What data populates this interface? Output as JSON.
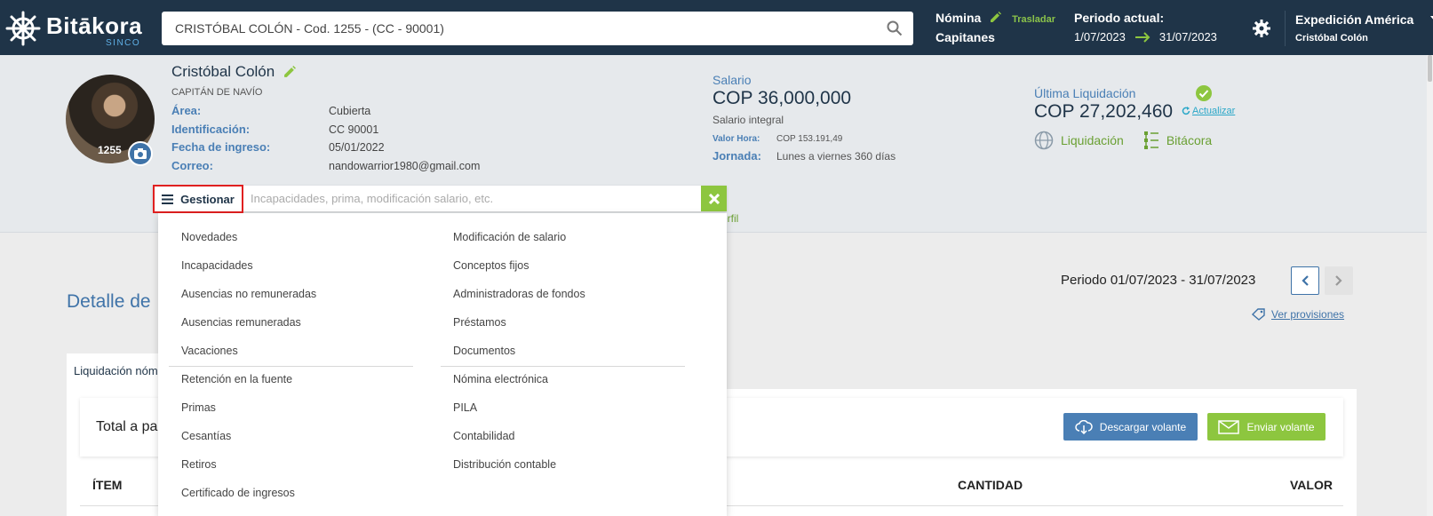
{
  "app": {
    "brand": "Bitākora",
    "sub_brand": "SINCO"
  },
  "search": {
    "value": "CRISTÓBAL COLÓN - Cod. 1255 - (CC - 90001)"
  },
  "nomina": {
    "title": "Nómina",
    "trasladar": "Trasladar",
    "name": "Capitanes"
  },
  "periodo_actual": {
    "label": "Periodo actual:",
    "start": "1/07/2023",
    "end": "31/07/2023"
  },
  "company": {
    "name": "Expedición América",
    "user": "Cristóbal Colón"
  },
  "employee": {
    "name": "Cristóbal Colón",
    "role": "CAPITÁN DE NAVÍO",
    "code": "1255",
    "fields": [
      {
        "label": "Área:",
        "value": "Cubierta"
      },
      {
        "label": "Identificación:",
        "value": "CC 90001"
      },
      {
        "label": "Fecha de ingreso:",
        "value": "05/01/2022"
      },
      {
        "label": "Correo:",
        "value": "nandowarrior1980@gmail.com"
      }
    ]
  },
  "salario": {
    "label": "Salario",
    "value": "COP 36,000,000",
    "type": "Salario integral",
    "valor_hora_label": "Valor Hora:",
    "valor_hora": "COP 153.191,49",
    "jornada_label": "Jornada:",
    "jornada": "Lunes a viernes 360 días"
  },
  "ultima_liquidacion": {
    "label": "Última Liquidación",
    "value": "COP 27,202,460",
    "actualizar": "Actualizar",
    "link1": "Liquidación",
    "link2": "Bitácora"
  },
  "perfil_fragment": "erfil",
  "gestionar": {
    "button": "Gestionar",
    "placeholder": "Incapacidades, prima, modificación salario, etc."
  },
  "menu": {
    "left": [
      "Novedades",
      "Incapacidades",
      "Ausencias no remuneradas",
      "Ausencias remuneradas",
      "Vacaciones",
      "Retención en la fuente",
      "Primas",
      "Cesantías",
      "Retiros",
      "Certificado de ingresos"
    ],
    "right": [
      "Modificación de salario",
      "Conceptos fijos",
      "Administradoras de fondos",
      "Préstamos",
      "Documentos",
      "Nómina electrónica",
      "PILA",
      "Contabilidad",
      "Distribución contable"
    ]
  },
  "detalle_title": "Detalle de",
  "periodo_nav": "Periodo 01/07/2023 - 31/07/2023",
  "ver_provisiones": "Ver provisiones",
  "tab_label": "Liquidación nóm",
  "total_label": "Total a pa",
  "buttons": {
    "descargar": "Descargar volante",
    "enviar": "Enviar volante"
  },
  "table_headers": {
    "item": "ÍTEM",
    "cantidad": "CANTIDAD",
    "valor": "VALOR"
  },
  "colors": {
    "topbar": "#1f3448",
    "accent_blue": "#3f73a8",
    "accent_green": "#8dc63f",
    "highlight_red": "#e02020"
  }
}
